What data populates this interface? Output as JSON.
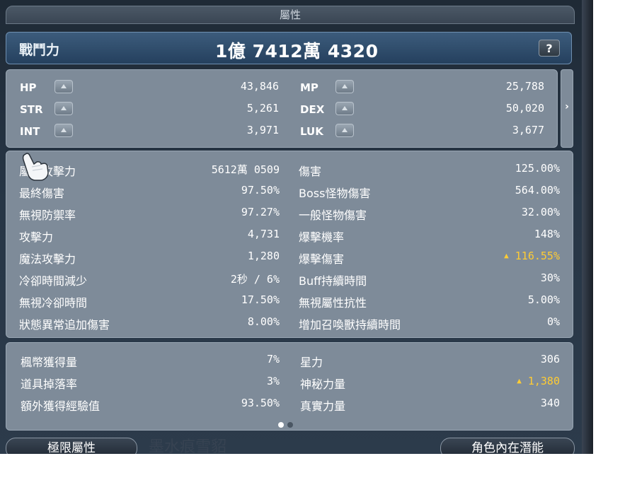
{
  "window": {
    "title": "屬性"
  },
  "combat": {
    "label": "戰鬥力",
    "value": "1億 7412萬 4320",
    "help_label": "?"
  },
  "stats": [
    {
      "name": "HP",
      "value": "43,846"
    },
    {
      "name": "MP",
      "value": "25,788"
    },
    {
      "name": "STR",
      "value": "5,261"
    },
    {
      "name": "DEX",
      "value": "50,020"
    },
    {
      "name": "INT",
      "value": "3,971"
    },
    {
      "name": "LUK",
      "value": "3,677"
    }
  ],
  "details_left": [
    {
      "label": "屬性攻擊力",
      "value": "5612萬 0509"
    },
    {
      "label": "最終傷害",
      "value": "97.50%"
    },
    {
      "label": "無視防禦率",
      "value": "97.27%"
    },
    {
      "label": "攻擊力",
      "value": "4,731"
    },
    {
      "label": "魔法攻擊力",
      "value": "1,280"
    },
    {
      "label": "冷卻時間減少",
      "value": "2秒 / 6%"
    },
    {
      "label": "無視冷卻時間",
      "value": "17.50%"
    },
    {
      "label": "狀態異常追加傷害",
      "value": "8.00%"
    }
  ],
  "details_right": [
    {
      "label": "傷害",
      "value": "125.00%"
    },
    {
      "label": "Boss怪物傷害",
      "value": "564.00%"
    },
    {
      "label": "一般怪物傷害",
      "value": "32.00%"
    },
    {
      "label": "爆擊機率",
      "value": "148%"
    },
    {
      "label": "爆擊傷害",
      "value": "116.55%",
      "highlight": true
    },
    {
      "label": "Buff持續時間",
      "value": "30%"
    },
    {
      "label": "無視屬性抗性",
      "value": "5.00%"
    },
    {
      "label": "增加召喚獸持續時間",
      "value": "0%"
    }
  ],
  "extra_left": [
    {
      "label": "楓幣獲得量",
      "value": "7%"
    },
    {
      "label": "道具掉落率",
      "value": "3%"
    },
    {
      "label": "額外獲得經驗值",
      "value": "93.50%"
    }
  ],
  "extra_right": [
    {
      "label": "星力",
      "value": "306"
    },
    {
      "label": "神秘力量",
      "value": "1,380",
      "highlight": true
    },
    {
      "label": "真實力量",
      "value": "340"
    }
  ],
  "pagination": {
    "current": 1,
    "total": 2
  },
  "buttons": {
    "limit_attr": "極限屬性",
    "inner_ability": "角色內在潛能"
  },
  "background_text": "墨水痕雪貂",
  "colors": {
    "highlight": "#ffcc33",
    "panel": "#7e8b99",
    "combat_panel": "#2f4d6d"
  }
}
